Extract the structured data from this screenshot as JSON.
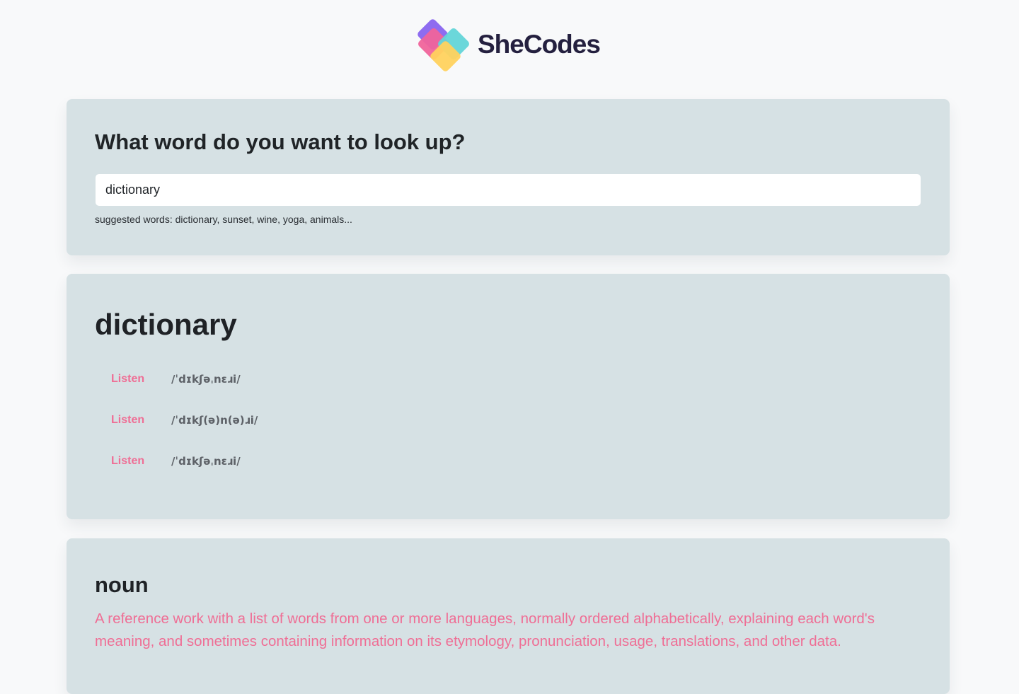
{
  "brand": {
    "name": "SheCodes",
    "colors": {
      "purple": "#8e6cf0",
      "pink": "#f0649b",
      "teal": "#63d5d8",
      "yellow": "#ffd25e",
      "text": "#24203f"
    }
  },
  "search": {
    "heading": "What word do you want to look up?",
    "value": "dictionary",
    "hint": "suggested words: dictionary, sunset, wine, yoga, animals..."
  },
  "result": {
    "word": "dictionary",
    "phonetics": [
      {
        "listen_label": "Listen",
        "text": "/ˈdɪkʃəˌnɛɹi/"
      },
      {
        "listen_label": "Listen",
        "text": "/ˈdɪkʃ(ə)n(ə)ɹi/"
      },
      {
        "listen_label": "Listen",
        "text": "/ˈdɪkʃəˌnɛɹi/"
      }
    ]
  },
  "meanings": [
    {
      "part_of_speech": "noun",
      "definition": "A reference work with a list of words from one or more languages, normally ordered alphabetically, explaining each word's meaning, and sometimes containing information on its etymology, pronunciation, usage, translations, and other data."
    }
  ],
  "theme": {
    "page_background": "#f8f9fa",
    "card_background": "#d6e1e4",
    "accent": "#ef6e95",
    "phonetic_text": "#5d6167"
  }
}
